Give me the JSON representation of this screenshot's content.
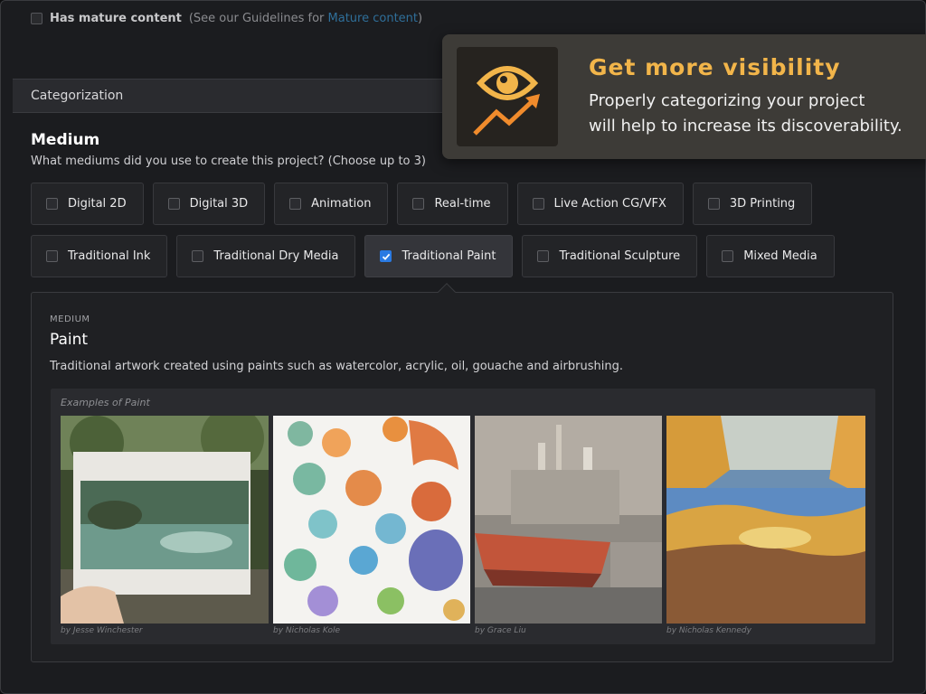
{
  "mature": {
    "label": "Has mature content",
    "hint_prefix": "(See our Guidelines for ",
    "hint_link": "Mature content",
    "hint_suffix": ")"
  },
  "categorization": {
    "title": "Categorization"
  },
  "medium": {
    "title": "Medium",
    "subtitle": "What mediums did you use to create this project? (Choose up to 3)",
    "options_row1": [
      {
        "label": "Digital 2D",
        "checked": false
      },
      {
        "label": "Digital 3D",
        "checked": false
      },
      {
        "label": "Animation",
        "checked": false
      },
      {
        "label": "Real-time",
        "checked": false
      },
      {
        "label": "Live Action CG/VFX",
        "checked": false
      },
      {
        "label": "3D Printing",
        "checked": false
      }
    ],
    "options_row2": [
      {
        "label": "Traditional Ink",
        "checked": false
      },
      {
        "label": "Traditional Dry Media",
        "checked": false
      },
      {
        "label": "Traditional Paint",
        "checked": true
      },
      {
        "label": "Traditional Sculpture",
        "checked": false
      },
      {
        "label": "Mixed Media",
        "checked": false
      }
    ]
  },
  "detail": {
    "kicker": "MEDIUM",
    "name": "Paint",
    "description": "Traditional artwork created using paints such as watercolor, acrylic, oil, gouache and airbrushing.",
    "examples_label": "Examples of Paint",
    "examples": [
      {
        "credit": "by Jesse Winchester"
      },
      {
        "credit": "by Nicholas Kole"
      },
      {
        "credit": "by Grace Liu"
      },
      {
        "credit": "by Nicholas Kennedy"
      }
    ]
  },
  "tooltip": {
    "icon": "eye-trend-up-icon",
    "title": "Get more visibility",
    "body_line1": "Properly categorizing your project",
    "body_line2": "will help to increase its discoverability."
  },
  "colors": {
    "accent_gold": "#f2b54a",
    "checkbox_blue": "#2a7ae2",
    "link_blue": "#2f6f9a"
  }
}
